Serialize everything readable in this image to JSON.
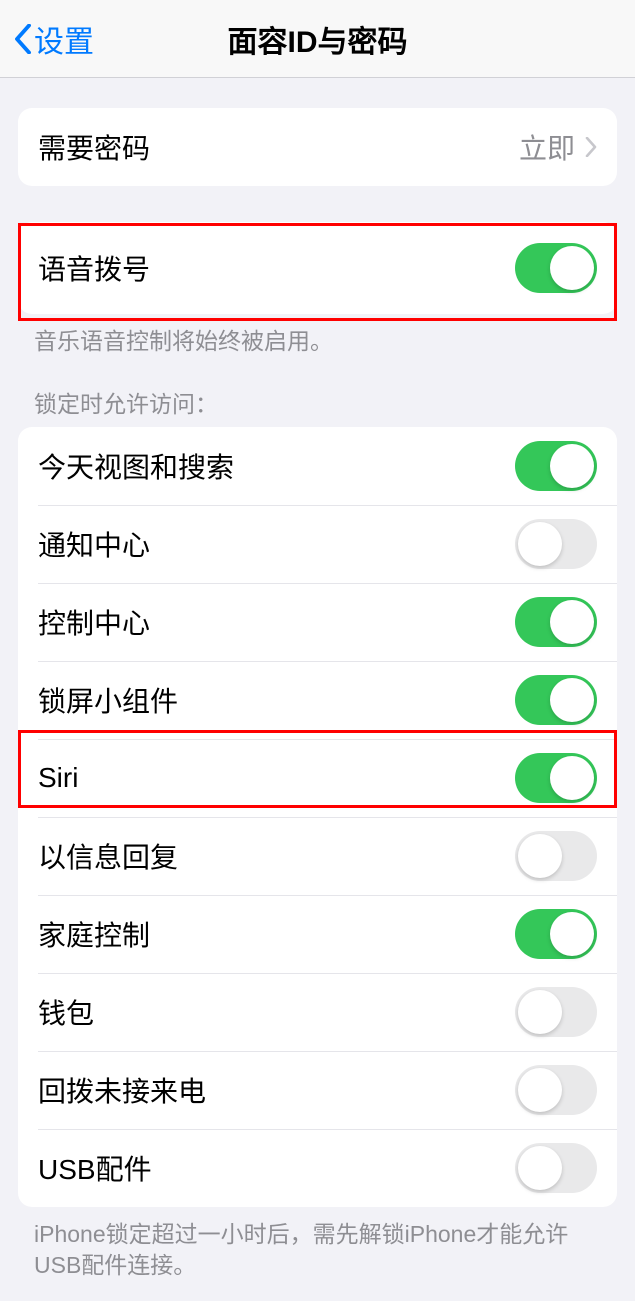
{
  "nav": {
    "back_label": "设置",
    "title": "面容ID与密码"
  },
  "section1": {
    "require_passcode": {
      "label": "需要密码",
      "value": "立即"
    }
  },
  "section2": {
    "voice_dial": {
      "label": "语音拨号",
      "on": true
    },
    "footer": "音乐语音控制将始终被启用。"
  },
  "section3": {
    "header": "锁定时允许访问：",
    "items": [
      {
        "label": "今天视图和搜索",
        "on": true
      },
      {
        "label": "通知中心",
        "on": false
      },
      {
        "label": "控制中心",
        "on": true
      },
      {
        "label": "锁屏小组件",
        "on": true
      },
      {
        "label": "Siri",
        "on": true
      },
      {
        "label": "以信息回复",
        "on": false
      },
      {
        "label": "家庭控制",
        "on": true
      },
      {
        "label": "钱包",
        "on": false
      },
      {
        "label": "回拨未接来电",
        "on": false
      },
      {
        "label": "USB配件",
        "on": false
      }
    ],
    "footer": "iPhone锁定超过一小时后，需先解锁iPhone才能允许USB配件连接。"
  }
}
